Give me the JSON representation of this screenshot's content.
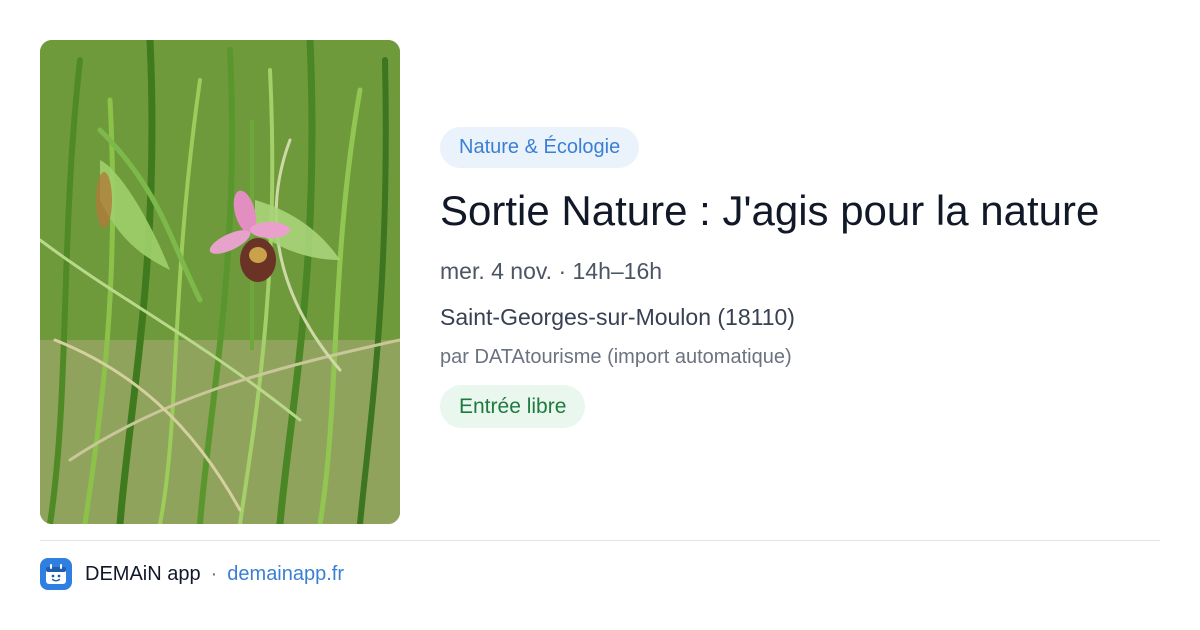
{
  "event": {
    "category": "Nature & Écologie",
    "title": "Sortie Nature : J'agis pour la nature",
    "datetime": "mer. 4 nov. · 14h–16h",
    "location": "Saint-Georges-sur-Moulon (18110)",
    "organizer": "par DATAtourisme (import automatique)",
    "price": "Entrée libre",
    "image_subject": "orchid-flower-in-grass-photo"
  },
  "footer": {
    "app_name": "DEMAiN app",
    "separator": "·",
    "link_text": "demainapp.fr",
    "icon": "demain-app-logo-icon"
  },
  "colors": {
    "category_chip_bg": "#eaf2fc",
    "category_chip_text": "#3b7fd4",
    "price_chip_bg": "#e9f7ee",
    "price_chip_text": "#1f7a3e",
    "link": "#3b7fd4",
    "app_icon_bg": "#2f7fe0"
  }
}
